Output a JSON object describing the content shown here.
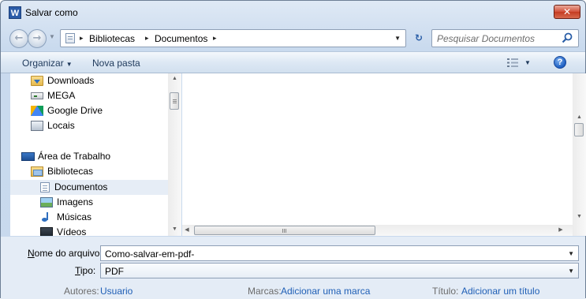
{
  "window": {
    "title": "Salvar como",
    "app_icon_letter": "W",
    "close_label": "✕"
  },
  "address_bar": {
    "breadcrumbs": [
      "Bibliotecas",
      "Documentos"
    ],
    "separator": "▸",
    "dropdown": "▼",
    "refresh": "↻",
    "history_dropdown": "▼"
  },
  "search": {
    "placeholder": "Pesquisar Documentos"
  },
  "toolbar": {
    "organize_label": "Organizar",
    "new_folder_label": "Nova pasta",
    "help": "?"
  },
  "nav_pane": {
    "items": [
      {
        "label": "Downloads",
        "icon": "downloads-folder-icon"
      },
      {
        "label": "MEGA",
        "icon": "drive-icon"
      },
      {
        "label": "Google Drive",
        "icon": "google-drive-icon"
      },
      {
        "label": "Locais",
        "icon": "network-location-icon"
      },
      {
        "label": "Área de Trabalho",
        "icon": "desktop-icon"
      },
      {
        "label": "Bibliotecas",
        "icon": "libraries-icon"
      },
      {
        "label": "Documentos",
        "icon": "documents-icon",
        "selected": true
      },
      {
        "label": "Imagens",
        "icon": "pictures-icon"
      },
      {
        "label": "Músicas",
        "icon": "music-icon"
      },
      {
        "label": "Vídeos",
        "icon": "videos-icon"
      }
    ]
  },
  "form": {
    "filename_label_accel": "N",
    "filename_label_rest": "ome do arquivo:",
    "filename_value": "Como-salvar-em-pdf-",
    "type_label_accel": "T",
    "type_label_rest": "ipo:",
    "type_value": "PDF",
    "authors_label": "Autores:",
    "authors_value": "Usuario",
    "tags_label": "Marcas:",
    "tags_value": "Adicionar uma marca",
    "title_label": "Título:",
    "title_value": "Adicionar um título"
  }
}
